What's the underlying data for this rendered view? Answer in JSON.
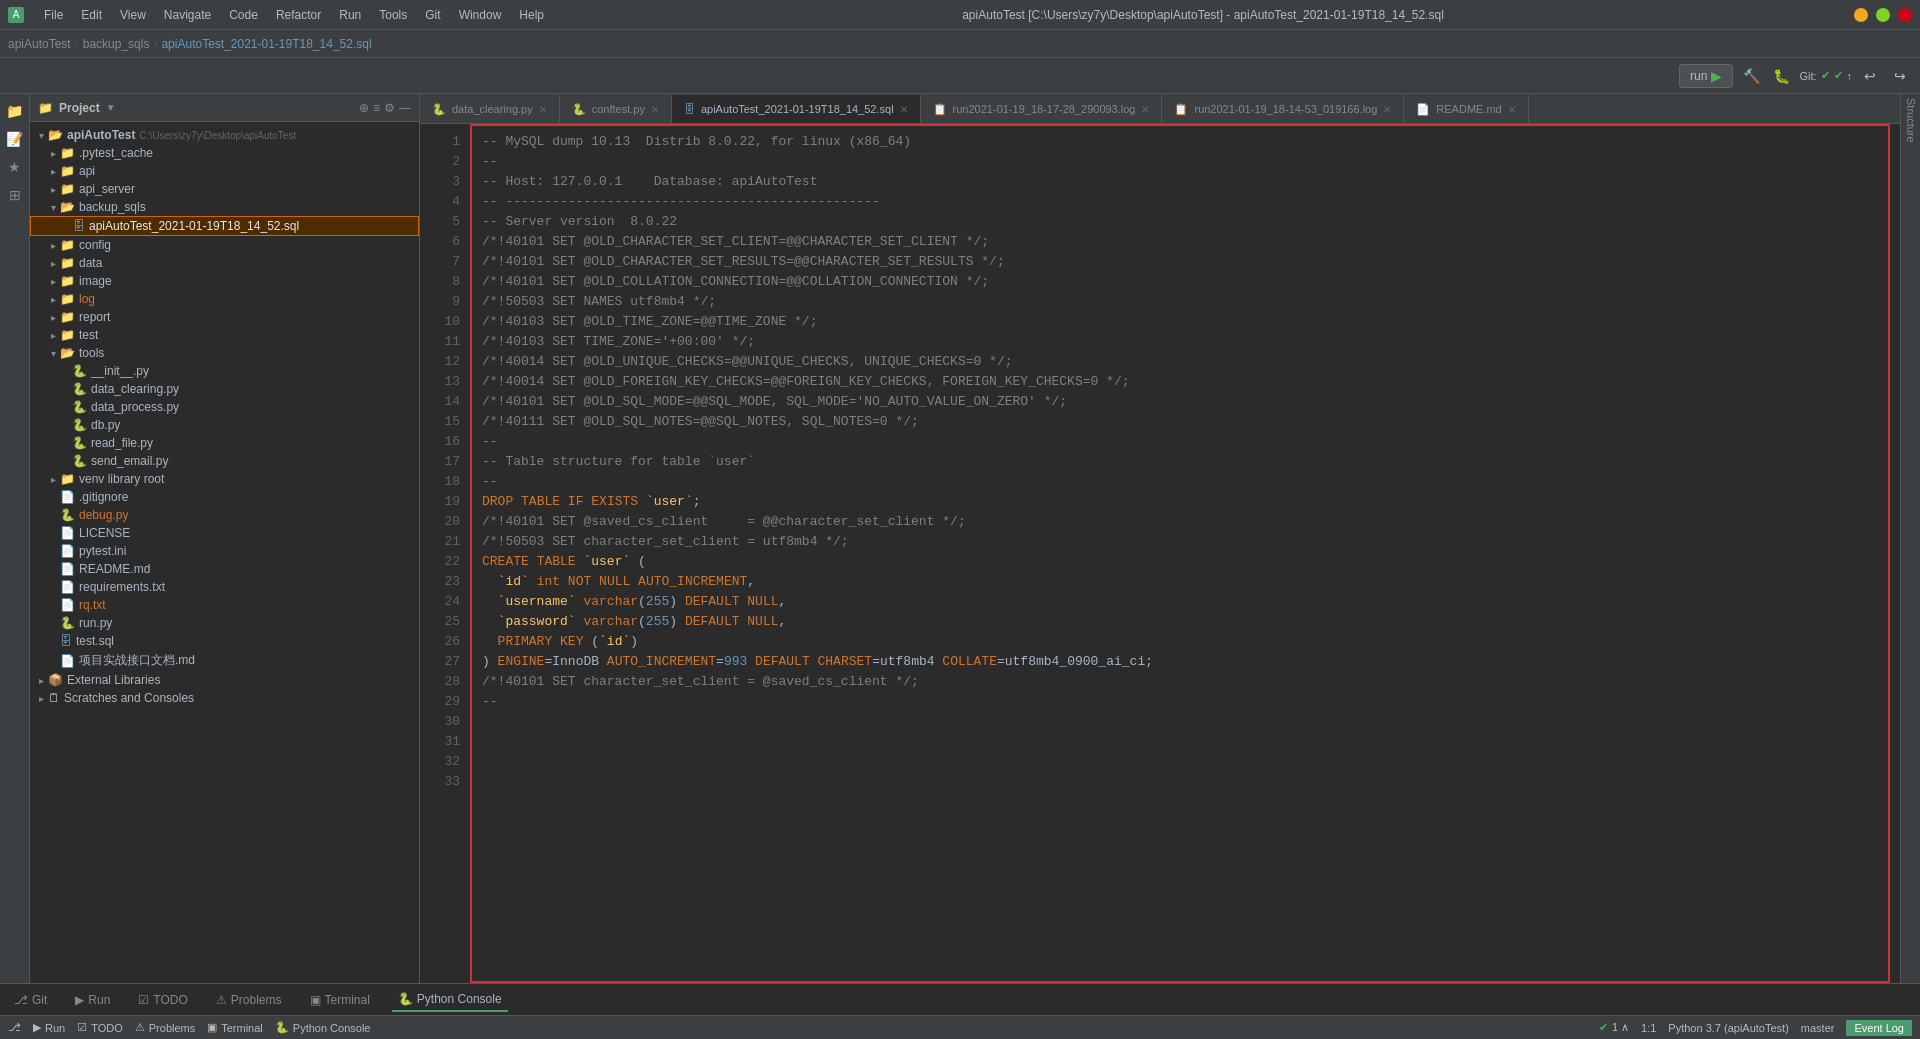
{
  "titleBar": {
    "appName": "apiAutoTest",
    "title": "apiAutoTest [C:\\Users\\zy7y\\Desktop\\apiAutoTest] - apiAutoTest_2021-01-19T18_14_52.sql",
    "menus": [
      "File",
      "Edit",
      "View",
      "Navigate",
      "Code",
      "Refactor",
      "Run",
      "Tools",
      "Git",
      "Window",
      "Help"
    ]
  },
  "breadcrumb": {
    "items": [
      "apiAutoTest",
      "backup_sqls",
      "apiAutoTest_2021-01-19T18_14_52.sql"
    ]
  },
  "toolbar": {
    "runLabel": "run",
    "gitStatus": "Git:",
    "undoIcon": "↩",
    "redoIcon": "↪"
  },
  "fileTree": {
    "title": "Project",
    "root": {
      "name": "apiAutoTest",
      "path": "C:\\Users\\zy7y\\Desktop\\apiAutoTest",
      "children": [
        {
          "name": ".pytest_cache",
          "type": "folder",
          "expanded": false
        },
        {
          "name": "api",
          "type": "folder",
          "expanded": false
        },
        {
          "name": "api_server",
          "type": "folder",
          "expanded": false
        },
        {
          "name": "backup_sqls",
          "type": "folder",
          "expanded": true,
          "children": [
            {
              "name": "apiAutoTest_2021-01-19T18_14_52.sql",
              "type": "sql",
              "selected": true,
              "highlighted": true
            }
          ]
        },
        {
          "name": "config",
          "type": "folder",
          "expanded": false
        },
        {
          "name": "data",
          "type": "folder",
          "expanded": false
        },
        {
          "name": "image",
          "type": "folder",
          "expanded": false
        },
        {
          "name": "log",
          "type": "folder",
          "expanded": false,
          "orange": true
        },
        {
          "name": "report",
          "type": "folder",
          "expanded": false
        },
        {
          "name": "test",
          "type": "folder",
          "expanded": false
        },
        {
          "name": "tools",
          "type": "folder",
          "expanded": true,
          "children": [
            {
              "name": "__init__.py",
              "type": "py"
            },
            {
              "name": "data_clearing.py",
              "type": "py"
            },
            {
              "name": "data_process.py",
              "type": "py"
            },
            {
              "name": "db.py",
              "type": "py"
            },
            {
              "name": "read_file.py",
              "type": "py"
            },
            {
              "name": "send_email.py",
              "type": "py"
            }
          ]
        },
        {
          "name": "venv  library root",
          "type": "folder",
          "expanded": false
        },
        {
          "name": ".gitignore",
          "type": "file"
        },
        {
          "name": "debug.py",
          "type": "py",
          "orange": true
        },
        {
          "name": "LICENSE",
          "type": "file"
        },
        {
          "name": "pytest.ini",
          "type": "ini"
        },
        {
          "name": "README.md",
          "type": "md"
        },
        {
          "name": "requirements.txt",
          "type": "txt"
        },
        {
          "name": "rq.txt",
          "type": "txt",
          "orange": true
        },
        {
          "name": "run.py",
          "type": "py"
        },
        {
          "name": "test.sql",
          "type": "sql"
        },
        {
          "name": "项目实战接口文档.md",
          "type": "md"
        }
      ]
    },
    "externalLibraries": "External Libraries",
    "scratchesAndConsoles": "Scratches and Consoles"
  },
  "tabs": [
    {
      "label": "data_clearing.py",
      "type": "py",
      "modified": true
    },
    {
      "label": "conftest.py",
      "type": "py",
      "modified": true
    },
    {
      "label": "apiAutoTest_2021-01-19T18_14_52.sql",
      "type": "sql",
      "active": true
    },
    {
      "label": "run2021-01-19_18-17-28_290093.log",
      "type": "log"
    },
    {
      "label": "run2021-01-19_18-14-53_019166.log",
      "type": "log"
    },
    {
      "label": "README.md",
      "type": "md"
    }
  ],
  "codeLines": [
    {
      "n": 1,
      "text": "-- MySQL dump 10.13  Distrib 8.0.22, for linux (x86_64)"
    },
    {
      "n": 2,
      "text": "--"
    },
    {
      "n": 3,
      "text": "-- Host: 127.0.0.1    Database: apiAutoTest"
    },
    {
      "n": 4,
      "text": "-- ------------------------------------------------"
    },
    {
      "n": 5,
      "text": "-- Server version  8.0.22"
    },
    {
      "n": 6,
      "text": ""
    },
    {
      "n": 7,
      "text": "/*!40101 SET @OLD_CHARACTER_SET_CLIENT=@@CHARACTER_SET_CLIENT */;"
    },
    {
      "n": 8,
      "text": "/*!40101 SET @OLD_CHARACTER_SET_RESULTS=@@CHARACTER_SET_RESULTS */;"
    },
    {
      "n": 9,
      "text": "/*!40101 SET @OLD_COLLATION_CONNECTION=@@COLLATION_CONNECTION */;"
    },
    {
      "n": 10,
      "text": "/*!50503 SET NAMES utf8mb4 */;"
    },
    {
      "n": 11,
      "text": "/*!40103 SET @OLD_TIME_ZONE=@@TIME_ZONE */;"
    },
    {
      "n": 12,
      "text": "/*!40103 SET TIME_ZONE='+00:00' */;"
    },
    {
      "n": 13,
      "text": "/*!40014 SET @OLD_UNIQUE_CHECKS=@@UNIQUE_CHECKS, UNIQUE_CHECKS=0 */;"
    },
    {
      "n": 14,
      "text": "/*!40014 SET @OLD_FOREIGN_KEY_CHECKS=@@FOREIGN_KEY_CHECKS, FOREIGN_KEY_CHECKS=0 */;"
    },
    {
      "n": 15,
      "text": "/*!40101 SET @OLD_SQL_MODE=@@SQL_MODE, SQL_MODE='NO_AUTO_VALUE_ON_ZERO' */;"
    },
    {
      "n": 16,
      "text": "/*!40111 SET @OLD_SQL_NOTES=@@SQL_NOTES, SQL_NOTES=0 */;"
    },
    {
      "n": 17,
      "text": ""
    },
    {
      "n": 18,
      "text": "--"
    },
    {
      "n": 19,
      "text": "-- Table structure for table `user`"
    },
    {
      "n": 20,
      "text": "--"
    },
    {
      "n": 21,
      "text": ""
    },
    {
      "n": 22,
      "text": "DROP TABLE IF EXISTS `user`;"
    },
    {
      "n": 23,
      "text": "/*!40101 SET @saved_cs_client     = @@character_set_client */;"
    },
    {
      "n": 24,
      "text": "/*!50503 SET character_set_client = utf8mb4 */;"
    },
    {
      "n": 25,
      "text": "CREATE TABLE `user` ("
    },
    {
      "n": 26,
      "text": "  `id` int NOT NULL AUTO_INCREMENT,"
    },
    {
      "n": 27,
      "text": "  `username` varchar(255) DEFAULT NULL,"
    },
    {
      "n": 28,
      "text": "  `password` varchar(255) DEFAULT NULL,"
    },
    {
      "n": 29,
      "text": "  PRIMARY KEY (`id`)"
    },
    {
      "n": 30,
      "text": ") ENGINE=InnoDB AUTO_INCREMENT=993 DEFAULT CHARSET=utf8mb4 COLLATE=utf8mb4_0900_ai_ci;"
    },
    {
      "n": 31,
      "text": "/*!40101 SET character_set_client = @saved_cs_client */;"
    },
    {
      "n": 32,
      "text": ""
    },
    {
      "n": 33,
      "text": "--"
    }
  ],
  "bottomTabs": [
    {
      "label": "Git",
      "icon": "⎇"
    },
    {
      "label": "Run",
      "icon": "▶"
    },
    {
      "label": "TODO",
      "icon": "☑"
    },
    {
      "label": "Problems",
      "icon": "⚠"
    },
    {
      "label": "Terminal",
      "icon": "▣"
    },
    {
      "label": "Python Console",
      "icon": "🐍",
      "active": true
    }
  ],
  "statusBar": {
    "position": "1:1",
    "pythonVersion": "Python 3.7 (apiAutoTest)",
    "branch": "master",
    "eventLog": "Event Log",
    "checkCount": "1 ∧"
  }
}
